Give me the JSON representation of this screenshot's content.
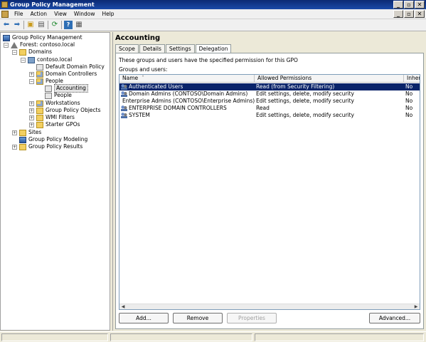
{
  "window": {
    "title": "Group Policy Management"
  },
  "menu": [
    "File",
    "Action",
    "View",
    "Window",
    "Help"
  ],
  "toolbar": [
    "back-icon",
    "forward-icon",
    "up-folder-icon",
    "show-hide-tree-icon",
    "refresh-icon",
    "help-icon",
    "properties-icon"
  ],
  "tree": {
    "root": "Group Policy Management",
    "forest": "Forest: contoso.local",
    "domains": "Domains",
    "domain": "contoso.local",
    "default_policy": "Default Domain Policy",
    "domain_controllers": "Domain Controllers",
    "people": "People",
    "accounting": "Accounting",
    "people_gpo": "People",
    "workstations": "Workstations",
    "gpo_folder": "Group Policy Objects",
    "wmi": "WMI Filters",
    "starter": "Starter GPOs",
    "sites": "Sites",
    "modeling": "Group Policy Modeling",
    "results": "Group Policy Results"
  },
  "details": {
    "title": "Accounting",
    "tabs": [
      "Scope",
      "Details",
      "Settings",
      "Delegation"
    ],
    "active_tab": "Delegation",
    "description": "These groups and users have the specified permission for this GPO",
    "groups_label": "Groups and users:",
    "columns": [
      "Name",
      "Allowed Permissions",
      "Inherit"
    ],
    "rows": [
      {
        "name": "Authenticated Users",
        "permission": "Read (from Security Filtering)",
        "inherited": "No"
      },
      {
        "name": "Domain Admins (CONTOSO\\Domain Admins)",
        "permission": "Edit settings, delete, modify security",
        "inherited": "No"
      },
      {
        "name": "Enterprise Admins (CONTOSO\\Enterprise Admins)",
        "permission": "Edit settings, delete, modify security",
        "inherited": "No"
      },
      {
        "name": "ENTERPRISE DOMAIN CONTROLLERS",
        "permission": "Read",
        "inherited": "No"
      },
      {
        "name": "SYSTEM",
        "permission": "Edit settings, delete, modify security",
        "inherited": "No"
      }
    ],
    "buttons": {
      "add": "Add...",
      "remove": "Remove",
      "properties": "Properties",
      "advanced": "Advanced..."
    }
  },
  "colors": {
    "titlebar": "#0b2a74",
    "selection": "#0a246a"
  }
}
